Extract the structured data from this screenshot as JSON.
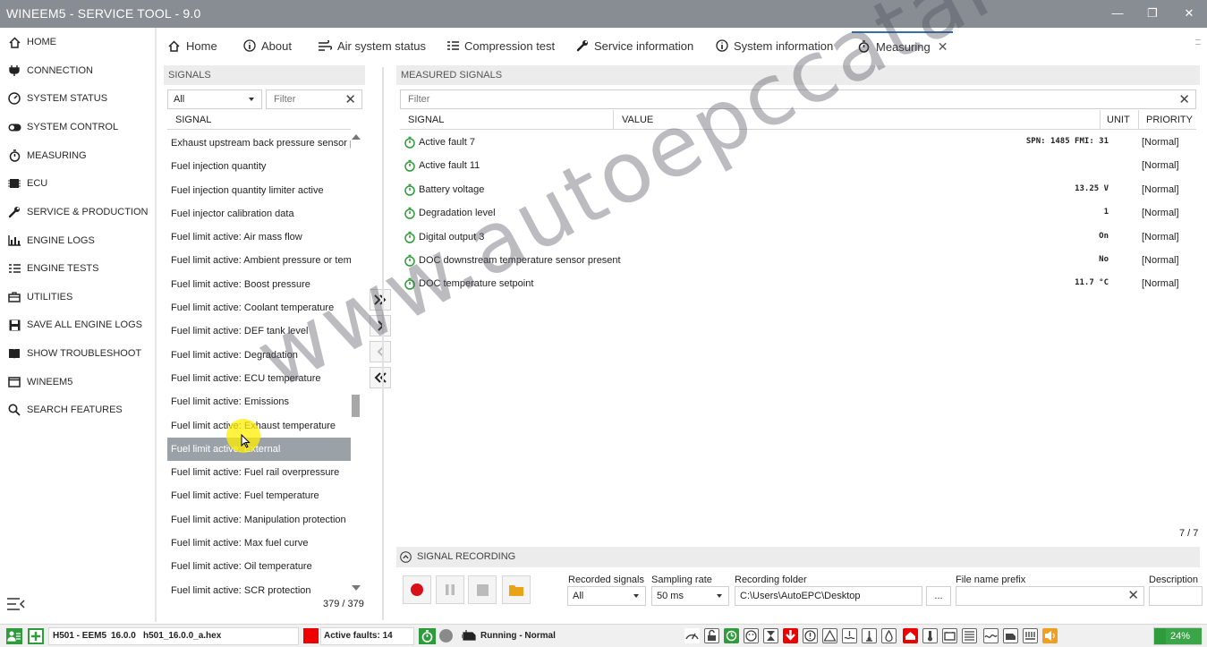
{
  "window": {
    "title": "WINEEM5 - SERVICE TOOL - 9.0"
  },
  "sidebar": {
    "items": [
      {
        "label": "HOME",
        "icon": "home-icon"
      },
      {
        "label": "CONNECTION",
        "icon": "plug-icon"
      },
      {
        "label": "SYSTEM STATUS",
        "icon": "gauge-icon"
      },
      {
        "label": "SYSTEM CONTROL",
        "icon": "toggle-icon"
      },
      {
        "label": "MEASURING",
        "icon": "stopwatch-icon"
      },
      {
        "label": "ECU",
        "icon": "chip-icon"
      },
      {
        "label": "SERVICE & PRODUCTION",
        "icon": "wrench-icon"
      },
      {
        "label": "ENGINE LOGS",
        "icon": "bar-chart-icon"
      },
      {
        "label": "ENGINE TESTS",
        "icon": "list-check-icon"
      },
      {
        "label": "UTILITIES",
        "icon": "briefcase-icon"
      },
      {
        "label": "SAVE ALL ENGINE LOGS",
        "icon": "save-icon"
      },
      {
        "label": "SHOW TROUBLESHOOT",
        "icon": "book-icon"
      },
      {
        "label": "WINEEM5",
        "icon": "window-icon"
      },
      {
        "label": "SEARCH FEATURES",
        "icon": "search-icon"
      }
    ]
  },
  "tabs": [
    {
      "label": "Home",
      "icon": "home-icon"
    },
    {
      "label": "About",
      "icon": "info-icon"
    },
    {
      "label": "Air system status",
      "icon": "air-icon"
    },
    {
      "label": "Compression test",
      "icon": "list-check-icon"
    },
    {
      "label": "Service information",
      "icon": "wrench-icon"
    },
    {
      "label": "System information",
      "icon": "info-icon"
    },
    {
      "label": "Measuring",
      "icon": "stopwatch-icon",
      "close": "✕"
    }
  ],
  "signals": {
    "header": "SIGNALS",
    "category": "All",
    "filter_placeholder": "Filter",
    "column": "SIGNAL",
    "count": "379 / 379",
    "items": [
      "Exhaust upstream back pressure sensor present",
      "Fuel injection quantity",
      "Fuel injection quantity limiter active",
      "Fuel injector calibration data",
      "Fuel limit active: Air mass flow",
      "Fuel limit active: Ambient pressure or temperature",
      "Fuel limit active: Boost pressure",
      "Fuel limit active: Coolant temperature",
      "Fuel limit active: DEF tank level",
      "Fuel limit active: Degradation",
      "Fuel limit active: ECU temperature",
      "Fuel limit active: Emissions",
      "Fuel limit active: Exhaust temperature",
      "Fuel limit active: External",
      "Fuel limit active: Fuel rail overpressure",
      "Fuel limit active: Fuel temperature",
      "Fuel limit active: Manipulation protection",
      "Fuel limit active: Max fuel curve",
      "Fuel limit active: Oil temperature",
      "Fuel limit active: SCR protection"
    ],
    "selected_index": 13
  },
  "measured": {
    "header": "MEASURED SIGNALS",
    "filter_placeholder": "Filter",
    "columns": {
      "signal": "SIGNAL",
      "value": "VALUE",
      "unit": "UNIT",
      "priority": "PRIORITY"
    },
    "count": "7 / 7",
    "rows": [
      {
        "name": "Active fault 7",
        "value": "SPN: 1485 FMI: 31",
        "priority": "[Normal]"
      },
      {
        "name": "Active fault 11",
        "value": "",
        "priority": "[Normal]"
      },
      {
        "name": "Battery voltage",
        "value": "13.25  V",
        "priority": "[Normal]"
      },
      {
        "name": "Degradation level",
        "value": "1",
        "priority": "[Normal]"
      },
      {
        "name": "Digital output 3",
        "value": "On",
        "priority": "[Normal]"
      },
      {
        "name": "DOC downstream temperature sensor present",
        "value": "No",
        "priority": "[Normal]"
      },
      {
        "name": "DOC temperature setpoint",
        "value": "11.7  °C",
        "priority": "[Normal]"
      }
    ]
  },
  "recording": {
    "header": "SIGNAL RECORDING",
    "recorded_label": "Recorded signals",
    "recorded_value": "All",
    "rate_label": "Sampling rate",
    "rate_value": "50 ms",
    "folder_label": "Recording folder",
    "folder_value": "C:\\Users\\AutoEPC\\Desktop",
    "browse": "...",
    "prefix_label": "File name prefix",
    "description_label": "Description"
  },
  "statusbar": {
    "model": "H501 - EEM5",
    "version": "16.0.0",
    "file": "h501_16.0.0_a.hex",
    "faults": "Active faults: 14",
    "state": "Running - Normal",
    "percent": "24%"
  },
  "watermark": "www.autoepccatalog.com",
  "colors": {
    "accent": "#2f6fb0",
    "fault_red": "#ee0000",
    "ok_green": "#2e9c3a",
    "selected_row": "#9aa1a7",
    "titlebar": "#878d93"
  }
}
